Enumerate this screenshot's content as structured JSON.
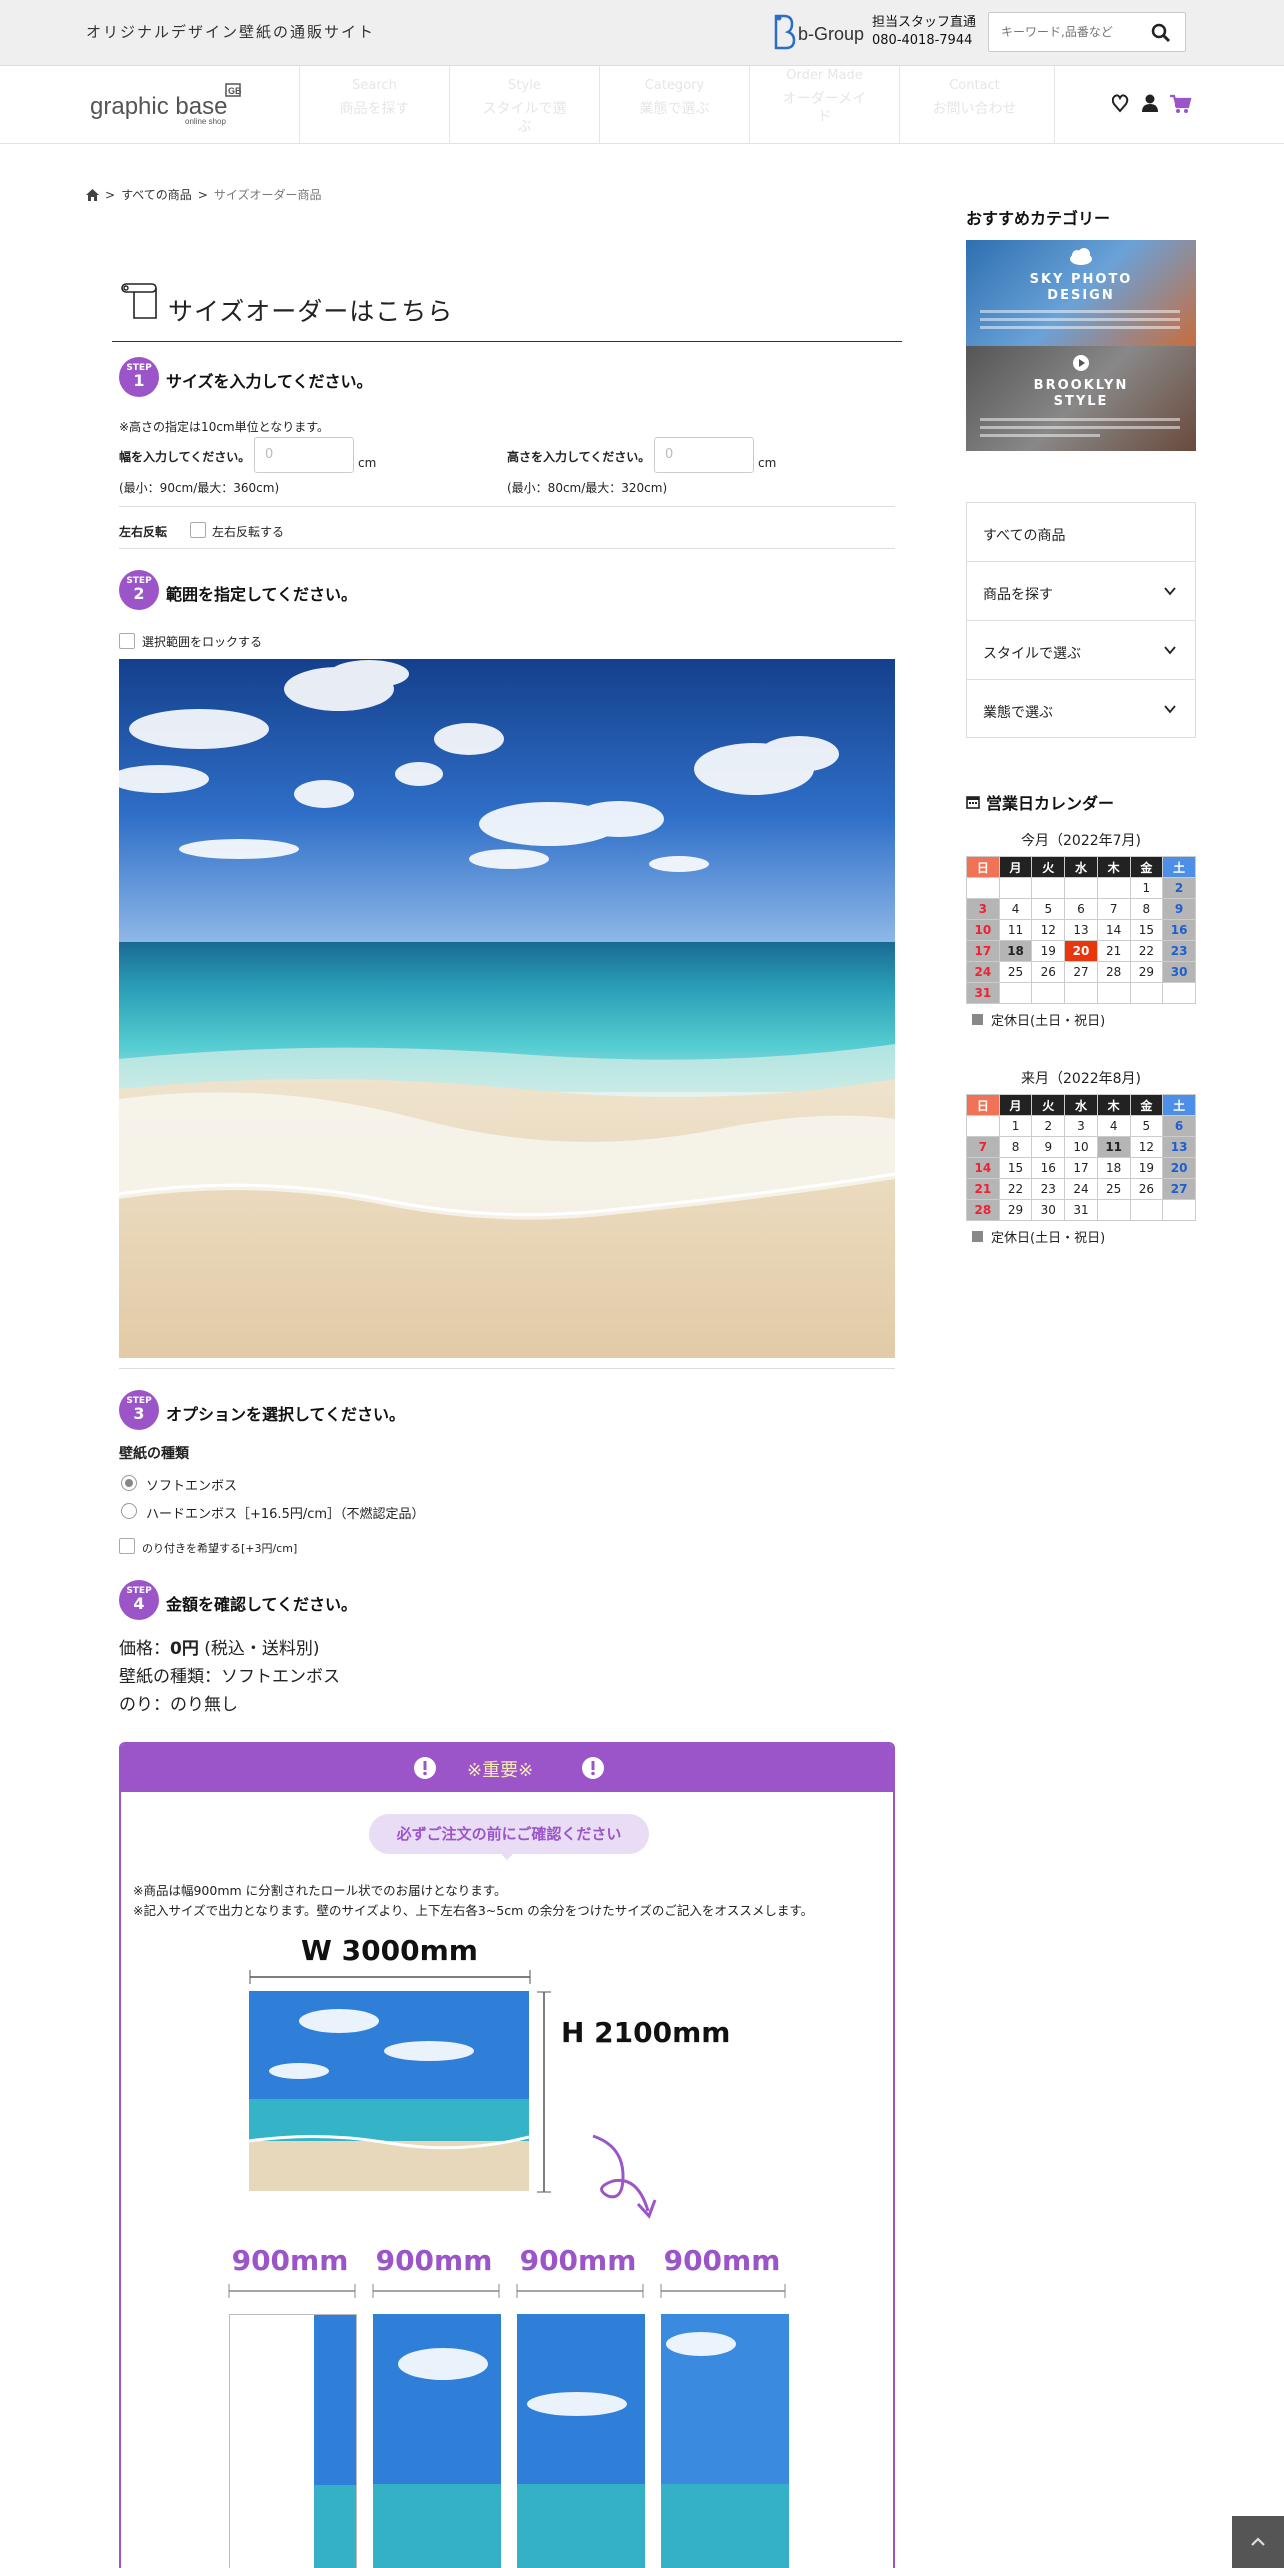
{
  "header": {
    "tagline": "オリジナルデザイン壁紙の通販サイト",
    "company": "b-Group",
    "staff_label": "担当スタッフ直通",
    "phone": "080-4018-7944",
    "search_placeholder": "キーワード,品番など"
  },
  "logo": {
    "main": "graphic base",
    "sub": "online shop",
    "badge": "GB"
  },
  "nav": [
    {
      "en": "Search",
      "jp": "商品を探す"
    },
    {
      "en": "Style",
      "jp": "スタイルで選",
      "jp2": "ぶ"
    },
    {
      "en": "Category",
      "jp": "業態で選ぶ"
    },
    {
      "en": "Order Made",
      "jp": "オーダーメイ",
      "jp2": "ド"
    },
    {
      "en": "Contact",
      "jp": "お問い合わせ"
    }
  ],
  "breadcrumb": {
    "all": "すべての商品",
    "current": "サイズオーダー商品",
    "sep": ">"
  },
  "page_title": "サイズオーダーはこちら",
  "step_word": "STEP",
  "steps": [
    {
      "num": "1",
      "title": "サイズを入力してください。"
    },
    {
      "num": "2",
      "title": "範囲を指定してください。"
    },
    {
      "num": "3",
      "title": "オプションを選択してください。"
    },
    {
      "num": "4",
      "title": "金額を確認してください。"
    }
  ],
  "size": {
    "note": "※高さの指定は10cm単位となります。",
    "width_label": "幅を入力してください。",
    "width_placeholder": "0",
    "width_unit": "cm",
    "width_range": "(最小：90cm/最大：360cm)",
    "height_label": "高さを入力してください。",
    "height_placeholder": "0",
    "height_unit": "cm",
    "height_range": "(最小：80cm/最大：320cm)",
    "flip_label": "左右反転",
    "flip_option": "左右反転する"
  },
  "range": {
    "lock_label": "選択範囲をロックする"
  },
  "options": {
    "type_heading": "壁紙の種類",
    "soft": "ソフトエンボス",
    "hard": "ハードエンボス［+16.5円/cm］（不燃認定品）",
    "glue": "のり付きを希望する[+3円/cm]"
  },
  "price": {
    "label": "価格：",
    "value": "0円",
    "tax": "(税込・送料別)",
    "type_line": "壁紙の種類：ソフトエンボス",
    "glue_line": "のり：のり無し"
  },
  "notice": {
    "header": "※重要※",
    "bubble": "必ずご注文の前にご確認ください",
    "line1": "※商品は幅900mm に分割されたロール状でのお届けとなります。",
    "line2": "※記入サイズで出力となります。壁のサイズより、上下左右各3~5cm の余分をつけたサイズのご記入をオススメします。",
    "width_dim": "W 3000mm",
    "height_dim": "H 2100mm",
    "panel_width": "900mm"
  },
  "sidebar": {
    "rec_heading": "おすすめカテゴリー",
    "banner1_title": "SKY PHOTO",
    "banner1_title2": "DESIGN",
    "banner2_title": "BROOKLYN",
    "banner2_title2": "STYLE",
    "menu": [
      "すべての商品",
      "商品を探す",
      "スタイルで選ぶ",
      "業態で選ぶ"
    ],
    "cal_heading": "営業日カレンダー",
    "weekdays": [
      "日",
      "月",
      "火",
      "水",
      "木",
      "金",
      "土"
    ],
    "cal1_caption": "今月（2022年7月)",
    "cal2_caption": "来月（2022年8月)",
    "legend": "定休日(土日・祝日)"
  },
  "colors": {
    "accent": "#9b55c8",
    "holiday": "#b5b5b5",
    "today": "#e8370f",
    "saturday": "#4d8fe6",
    "sunday": "#f07357"
  }
}
